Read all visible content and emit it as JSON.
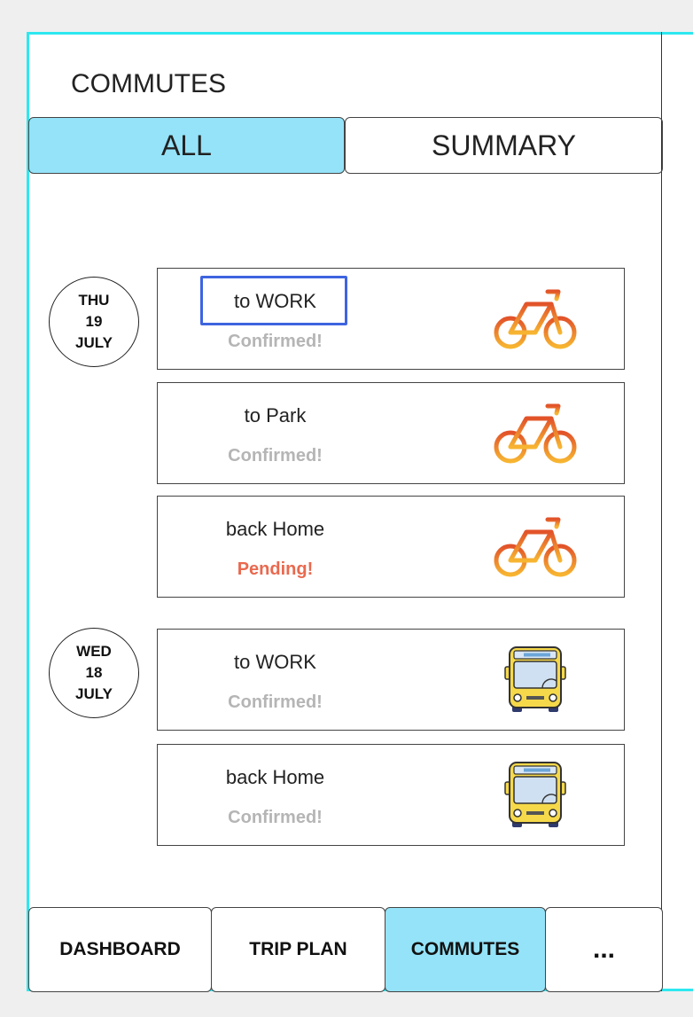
{
  "header": {
    "title": "COMMUTES"
  },
  "tabs": [
    {
      "label": "ALL",
      "active": true
    },
    {
      "label": "SUMMARY",
      "active": false
    }
  ],
  "days": [
    {
      "weekday": "THU",
      "day": "19",
      "month": "JULY",
      "commutes": [
        {
          "destination": "to WORK",
          "status": "Confirmed!",
          "mode_icon": "bicycle-icon"
        },
        {
          "destination": "to Park",
          "status": "Confirmed!",
          "mode_icon": "bicycle-icon"
        },
        {
          "destination": "back Home",
          "status": "Pending!",
          "mode_icon": "bicycle-icon"
        }
      ]
    },
    {
      "weekday": "WED",
      "day": "18",
      "month": "JULY",
      "commutes": [
        {
          "destination": "to WORK",
          "status": "Confirmed!",
          "mode_icon": "bus-icon"
        },
        {
          "destination": "back Home",
          "status": "Confirmed!",
          "mode_icon": "bus-icon"
        }
      ]
    }
  ],
  "bottom_nav": [
    {
      "label": "DASHBOARD",
      "active": false
    },
    {
      "label": "TRIP PLAN",
      "active": false
    },
    {
      "label": "COMMUTES",
      "active": true
    },
    {
      "label": "...",
      "active": false
    }
  ],
  "colors": {
    "accent": "#94e3f9",
    "frame": "#2ee8f0",
    "confirmed": "#b5b5b5",
    "pending": "#e9694f",
    "focus": "#3e64e0"
  }
}
